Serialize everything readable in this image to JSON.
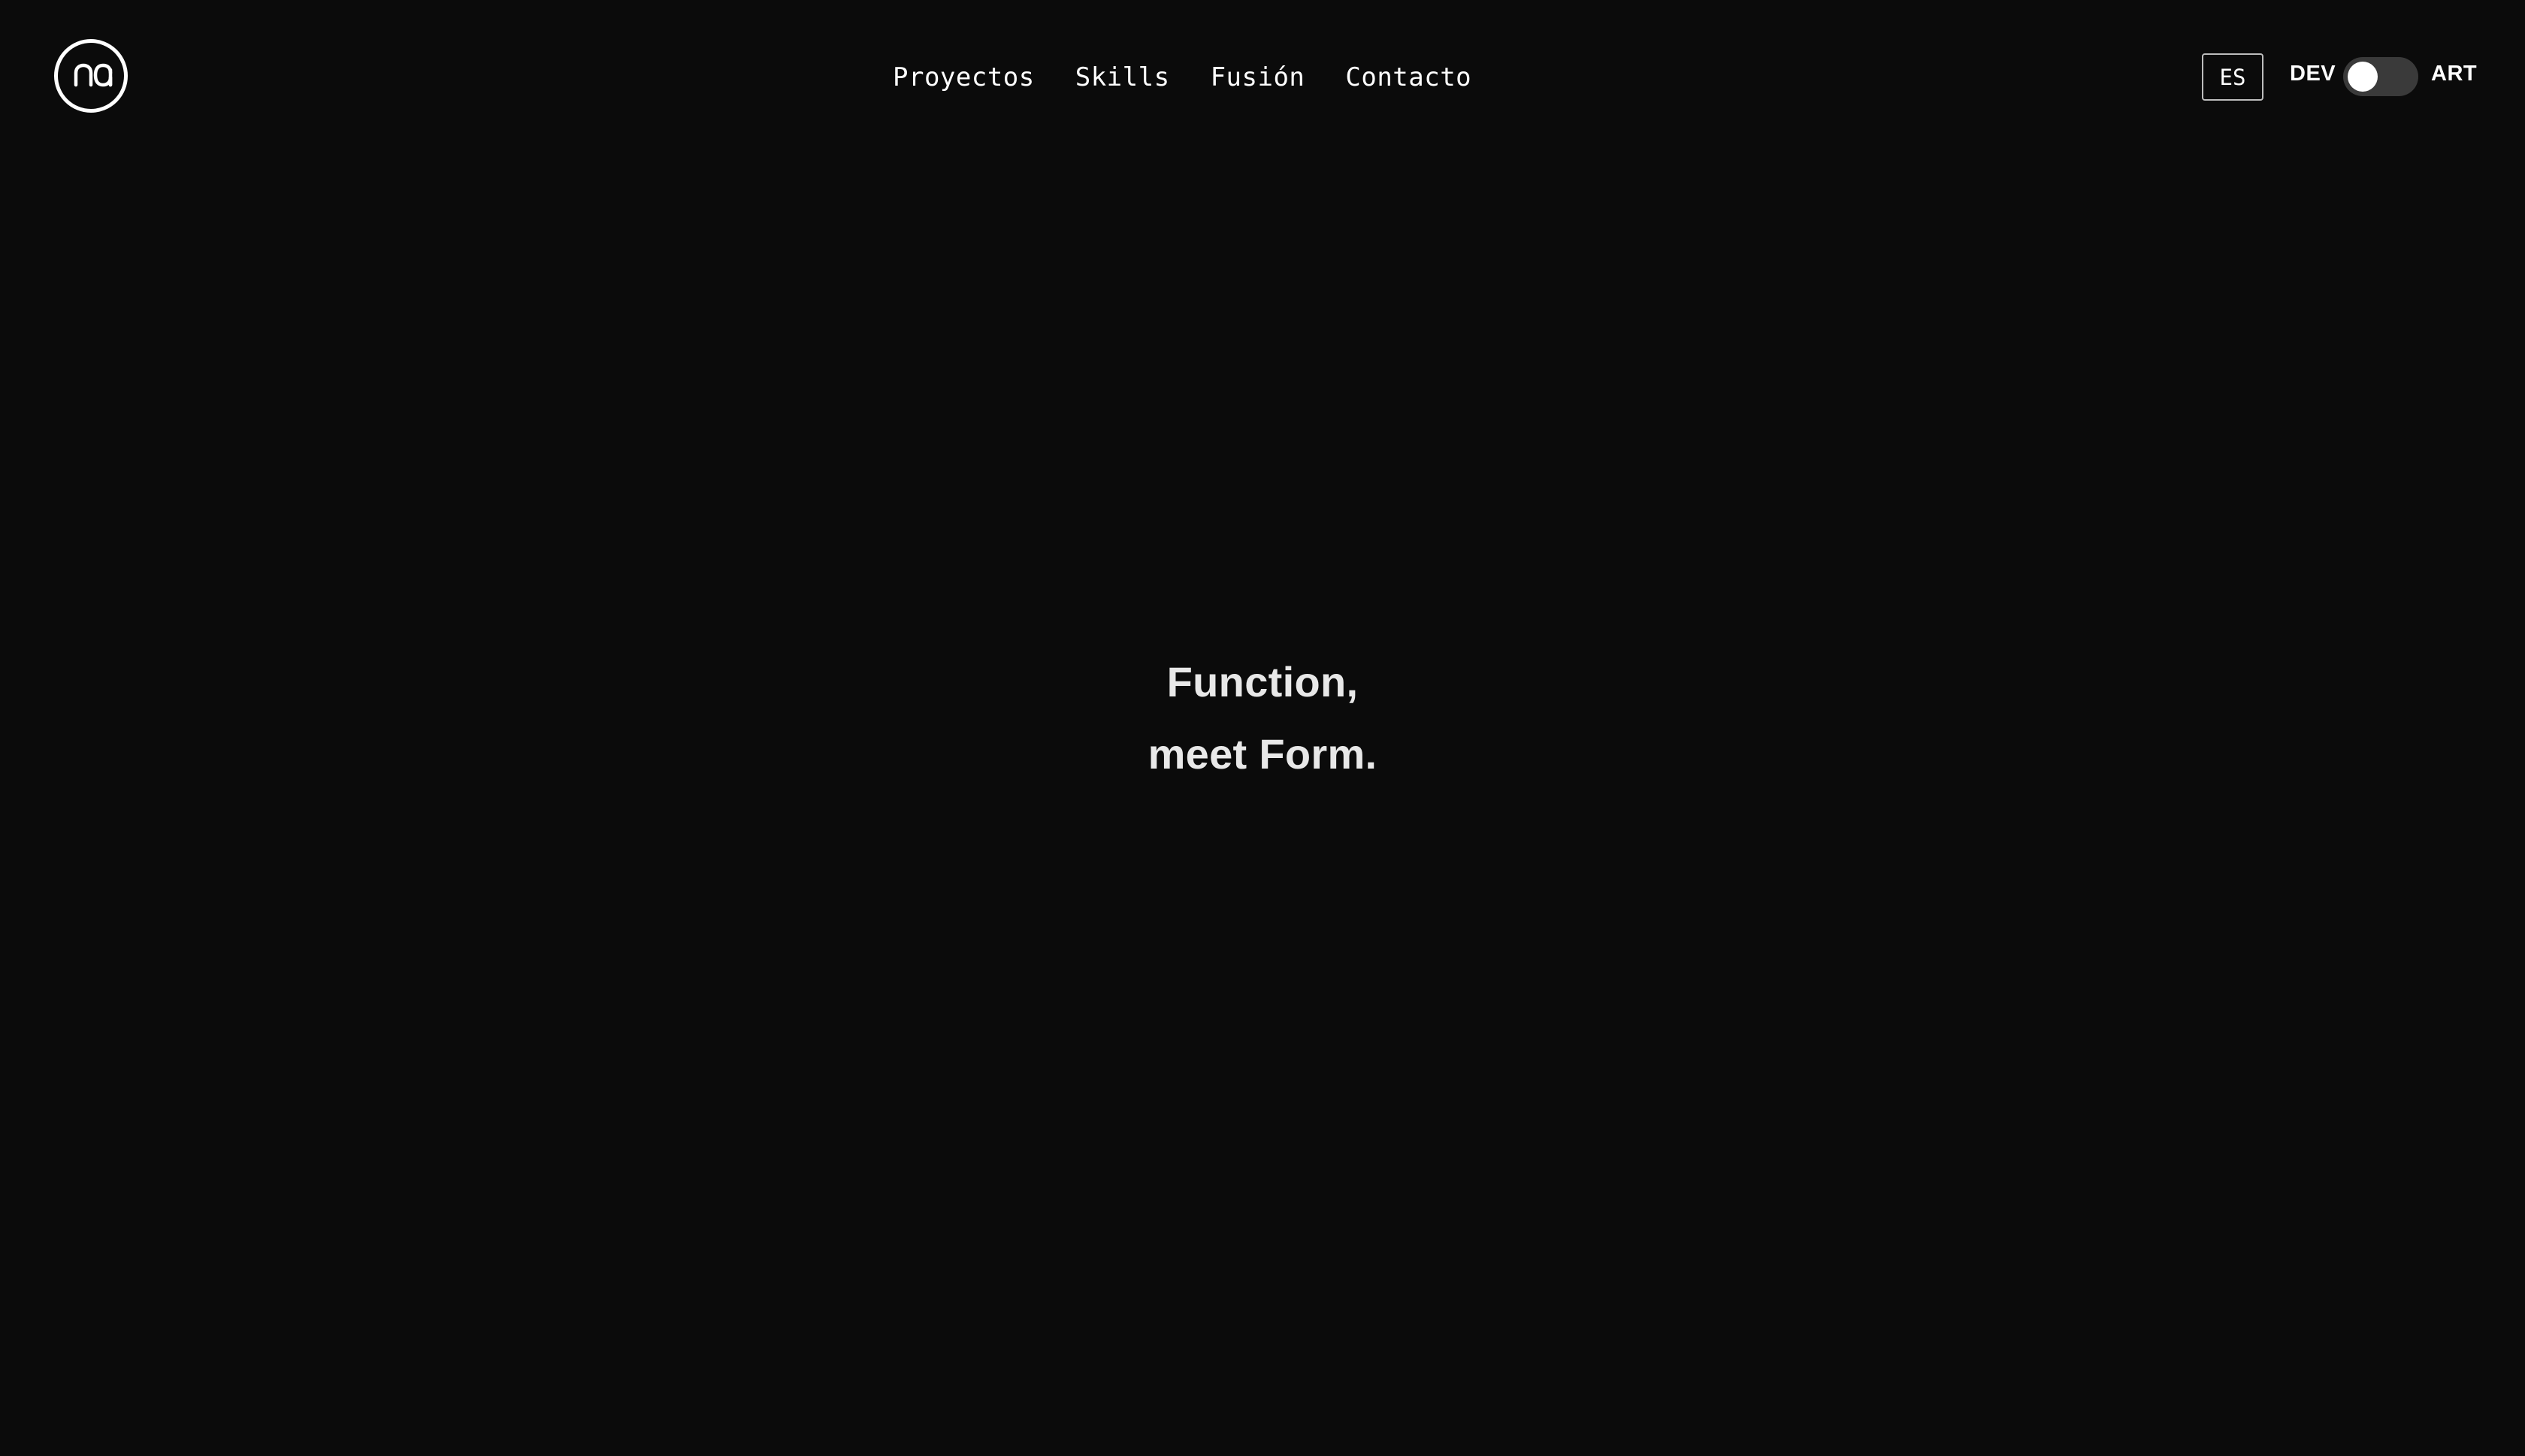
{
  "logo": {
    "text": "na",
    "icon": "na-monogram-logo"
  },
  "nav": {
    "items": [
      {
        "label": "Proyectos"
      },
      {
        "label": "Skills"
      },
      {
        "label": "Fusión"
      },
      {
        "label": "Contacto"
      }
    ]
  },
  "controls": {
    "language": "ES",
    "mode_left": "DEV",
    "mode_right": "ART",
    "toggle_state": "DEV"
  },
  "hero": {
    "line1": "Function,",
    "line2": "meet Form."
  },
  "colors": {
    "background": "#0b0b0b",
    "text": "#ffffff",
    "toggle_track": "#3a3a3a"
  }
}
